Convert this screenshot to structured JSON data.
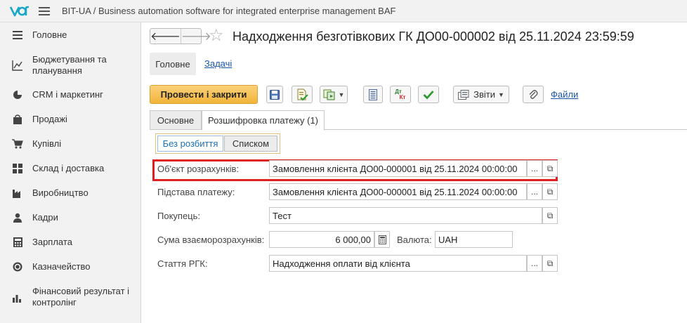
{
  "app": {
    "title": "BIT-UA / Business automation software for integrated enterprise management BAF"
  },
  "sidebar": {
    "items": [
      {
        "label": "Головне",
        "icon": "menu-lines-icon"
      },
      {
        "label": "Бюджетування та планування",
        "icon": "chart-line-icon"
      },
      {
        "label": "CRM і маркетинг",
        "icon": "pie-chart-icon"
      },
      {
        "label": "Продажі",
        "icon": "shopping-bag-icon"
      },
      {
        "label": "Купівлі",
        "icon": "cart-icon"
      },
      {
        "label": "Склад і доставка",
        "icon": "grid-icon"
      },
      {
        "label": "Виробництво",
        "icon": "factory-icon"
      },
      {
        "label": "Кадри",
        "icon": "person-icon"
      },
      {
        "label": "Зарплата",
        "icon": "calculator-icon"
      },
      {
        "label": "Казначейство",
        "icon": "coin-icon"
      },
      {
        "label": "Фінансовий результат і контролінг",
        "icon": "bar-chart-icon"
      }
    ]
  },
  "document": {
    "title": "Надходження безготівкових ГК ДО00-000002 від 25.11.2024 23:59:59",
    "nav_back": "🡐",
    "nav_forward": "🡒",
    "star": "☆"
  },
  "view_tabs": {
    "main": "Головне",
    "tasks": "Задачі"
  },
  "toolbar": {
    "post_and_close": "Провести і закрити",
    "reports": "Звіти",
    "files": "Файли",
    "dt_kt_top": "Дт",
    "dt_kt_bottom": "Кт"
  },
  "form_tabs": {
    "basic": "Основне",
    "payment_breakdown": "Розшифровка платежу (1)"
  },
  "split_mode": {
    "no_split": "Без розбиття",
    "list": "Списком"
  },
  "fields": {
    "settlement_object": {
      "label": "Об'єкт розрахунків:",
      "value": "Замовлення клієнта ДО00-000001 від 25.11.2024 00:00:00"
    },
    "payment_basis": {
      "label": "Підстава платежу:",
      "value": "Замовлення клієнта ДО00-000001 від 25.11.2024 00:00:00"
    },
    "buyer": {
      "label": "Покупець:",
      "value": "Тест"
    },
    "settlement_amount": {
      "label": "Сума взаєморозрахунків:",
      "value": "6 000,00"
    },
    "currency": {
      "label": "Валюта:",
      "value": "UAH"
    },
    "cash_flow_item": {
      "label": "Стаття РГК:",
      "value": "Надходження оплати від клієнта"
    }
  },
  "controls": {
    "ellipsis": "...",
    "open": "⧉"
  },
  "colors": {
    "accent_link": "#1a56a8",
    "primary_button": "#f1b43b",
    "highlight": "#e02020"
  }
}
